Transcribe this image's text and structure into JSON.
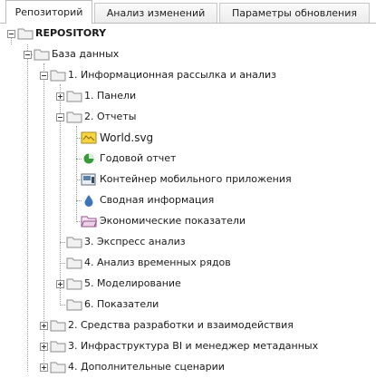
{
  "tabs": [
    {
      "label": "Репозиторий",
      "active": true
    },
    {
      "label": "Анализ изменений",
      "active": false
    },
    {
      "label": "Параметры обновления",
      "active": false
    }
  ],
  "tree": {
    "root": {
      "label": "REPOSITORY",
      "state": "expanded"
    },
    "database": {
      "label": "База данных",
      "state": "expanded"
    },
    "folder1": {
      "label": "1. Информационная рассылка и анализ",
      "state": "expanded"
    },
    "panels": {
      "label": "1. Панели",
      "state": "collapsed"
    },
    "reports": {
      "label": "2. Отчеты",
      "state": "expanded"
    },
    "reports_items": [
      {
        "label": "World.svg",
        "icon": "map-icon"
      },
      {
        "label": "Годовой отчет",
        "icon": "pie-chart-icon"
      },
      {
        "label": "Контейнер мобильного приложения",
        "icon": "mobile-container-icon"
      },
      {
        "label": "Сводная информация",
        "icon": "drop-icon"
      },
      {
        "label": "Экономические показатели",
        "icon": "open-folder-icon"
      }
    ],
    "express": {
      "label": "3. Экспресс анализ",
      "state": "leaf"
    },
    "timeseries": {
      "label": "4. Анализ временных рядов",
      "state": "leaf"
    },
    "modeling": {
      "label": "5. Моделирование",
      "state": "collapsed"
    },
    "indicators": {
      "label": "6. Показатели",
      "state": "leaf"
    },
    "dev": {
      "label": "2. Средства разработки и взаимодействия",
      "state": "collapsed"
    },
    "infra": {
      "label": "3. Инфраструктура BI и менеджер метаданных",
      "state": "collapsed"
    },
    "extra": {
      "label": "4. Дополнительные сценарии",
      "state": "collapsed"
    }
  },
  "colors": {
    "folder_body": "#f1f1f1",
    "folder_border": "#8c8c8c",
    "map_yellow": "#f6d542",
    "pie_green": "#3a9a3a",
    "drop_blue": "#3b74b8",
    "eco_folder": "#9a4f8c"
  }
}
